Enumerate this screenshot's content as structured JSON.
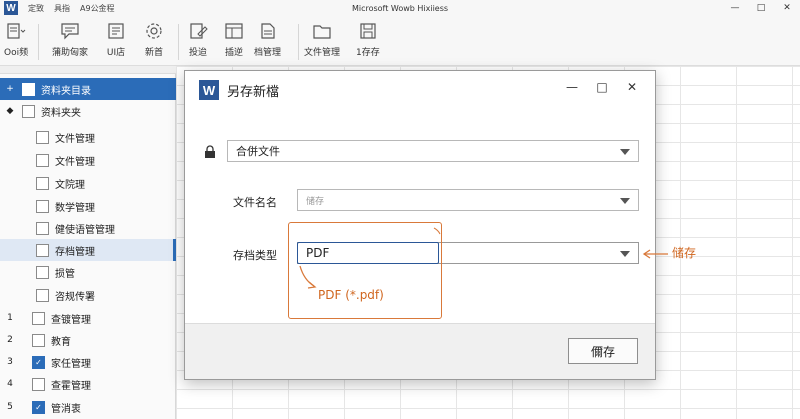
{
  "app": {
    "title": "Microsoft Wowb Hixiiess",
    "logo_letter": "W",
    "menu": [
      "定致",
      "具指",
      "A9公金程"
    ],
    "accent": "#2b6cb8",
    "brand": "#2b5797",
    "callout_color": "#d9793a"
  },
  "ribbon": {
    "buttons": [
      {
        "label": "Ooi频",
        "icon": "document-icon"
      },
      {
        "label": "蒲助匈家",
        "icon": "comment-icon"
      },
      {
        "label": "UI店",
        "icon": "store-icon"
      },
      {
        "label": "新首",
        "icon": "settings-icon"
      },
      {
        "label": "投迨",
        "icon": "edit-doc-icon"
      },
      {
        "label": "插逆",
        "icon": "template-icon"
      },
      {
        "label": "档管理",
        "icon": "file-icon"
      },
      {
        "label": "文件管理",
        "icon": "folder-icon"
      },
      {
        "label": "1存存",
        "icon": "save-icon"
      }
    ]
  },
  "sidebar": {
    "items": [
      {
        "marker": "+",
        "label": "资料夹目录",
        "checked": false
      },
      {
        "marker": "◆",
        "label": "资料夹夹",
        "checked": false
      },
      {
        "marker": "",
        "label": "文件管理",
        "checked": false
      },
      {
        "marker": "",
        "label": "文件管理",
        "checked": false
      },
      {
        "marker": "",
        "label": "文院理",
        "checked": false
      },
      {
        "marker": "",
        "label": "数学管理",
        "checked": false
      },
      {
        "marker": "",
        "label": "健使语管管理",
        "checked": false
      },
      {
        "marker": "",
        "label": "存档管理",
        "checked": false
      },
      {
        "marker": "",
        "label": "损管",
        "checked": false
      },
      {
        "marker": "",
        "label": "咨规传署",
        "checked": false
      },
      {
        "marker": "1",
        "label": "查镀管理",
        "checked": false
      },
      {
        "marker": "2",
        "label": "教育",
        "checked": false
      },
      {
        "marker": "3",
        "label": "家任管理",
        "checked": true
      },
      {
        "marker": "4",
        "label": "查霍管理",
        "checked": false
      },
      {
        "marker": "5",
        "label": "管消衷",
        "checked": true
      }
    ]
  },
  "dialog": {
    "logo_letter": "W",
    "title": "另存新檔",
    "merge_select": "合併文件",
    "filename_label": "文件名名",
    "filename_placeholder": "储存",
    "filetype_label": "存档类型",
    "filetype_value": "PDF",
    "save_button": "儞存"
  },
  "annotations": {
    "dropdown_option": "PDF (*.pdf)",
    "side_label": "储存"
  }
}
